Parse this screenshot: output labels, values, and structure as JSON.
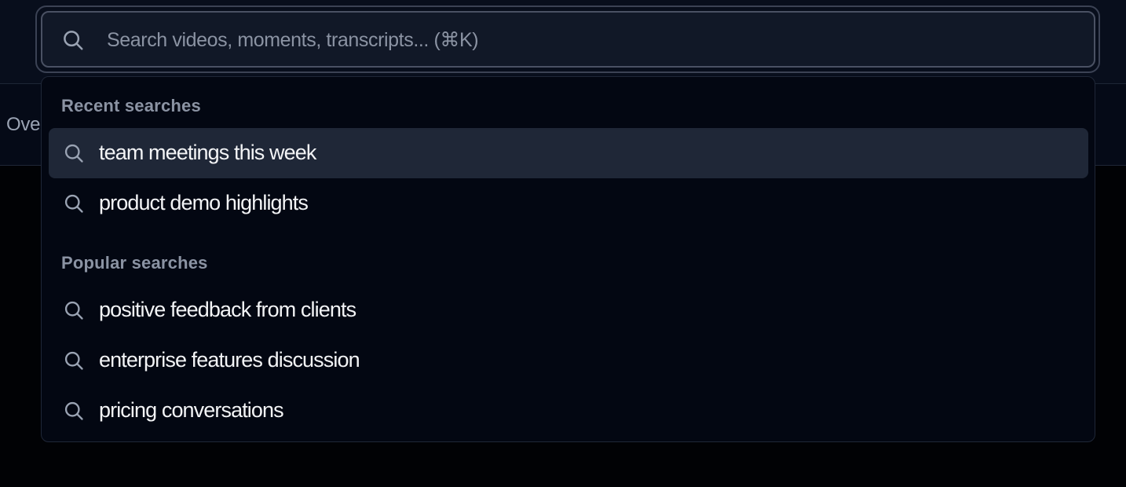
{
  "tabs": {
    "partial_label": "Ove"
  },
  "search": {
    "placeholder": "Search videos, moments, transcripts... (⌘K)",
    "value": "",
    "icon": "search-icon"
  },
  "dropdown": {
    "recent_title": "Recent searches",
    "recent": [
      {
        "label": "team meetings this week",
        "icon": "search-icon"
      },
      {
        "label": "product demo highlights",
        "icon": "search-icon"
      }
    ],
    "popular_title": "Popular searches",
    "popular": [
      {
        "label": "positive feedback from clients",
        "icon": "search-icon"
      },
      {
        "label": "enterprise features discussion",
        "icon": "search-icon"
      },
      {
        "label": "pricing conversations",
        "icon": "search-icon"
      }
    ]
  },
  "colors": {
    "background": "#010205",
    "header": "#080e1c",
    "dropdown": "#030712",
    "highlight": "#1f2737",
    "muted_text": "#8b93a3",
    "text": "#f3f4f6"
  }
}
